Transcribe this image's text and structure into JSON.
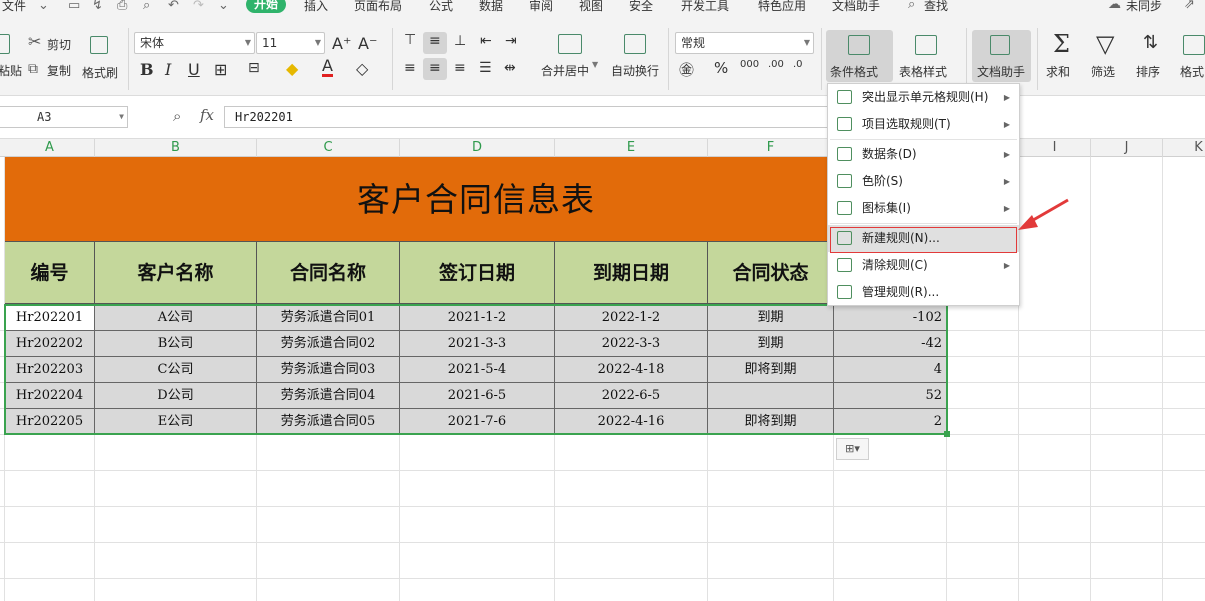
{
  "menubar": {
    "file": "文件",
    "tabs": [
      "开始",
      "插入",
      "页面布局",
      "公式",
      "数据",
      "审阅",
      "视图",
      "安全",
      "开发工具",
      "特色应用",
      "文档助手"
    ],
    "active_tab": "开始",
    "search": "查找",
    "sync": "未同步"
  },
  "ribbon": {
    "cut": "剪切",
    "paste": "粘贴",
    "copy": "复制",
    "format_painter": "格式刷",
    "font_name": "宋体",
    "font_size": "11",
    "merge_center": "合并居中",
    "wrap_text": "自动换行",
    "number_format": "常规",
    "conditional_format": "条件格式",
    "table_style": "表格样式",
    "doc_assistant": "文档助手",
    "sum": "求和",
    "filter": "筛选",
    "sort": "排序",
    "format": "格式"
  },
  "formula_bar": {
    "name_box": "A3",
    "fx": "fx",
    "value": "Hr202201"
  },
  "columns": [
    "A",
    "B",
    "C",
    "D",
    "E",
    "F",
    "G",
    "H",
    "I",
    "J",
    "K"
  ],
  "sheet": {
    "title": "客户合同信息表",
    "headers": [
      "编号",
      "客户名称",
      "合同名称",
      "签订日期",
      "到期日期",
      "合同状态"
    ],
    "rows": [
      [
        "Hr202201",
        "A公司",
        "劳务派遣合同01",
        "2021-1-2",
        "2022-1-2",
        "到期",
        "-102"
      ],
      [
        "Hr202202",
        "B公司",
        "劳务派遣合同02",
        "2021-3-3",
        "2022-3-3",
        "到期",
        "-42"
      ],
      [
        "Hr202203",
        "C公司",
        "劳务派遣合同03",
        "2021-5-4",
        "2022-4-18",
        "即将到期",
        "4"
      ],
      [
        "Hr202204",
        "D公司",
        "劳务派遣合同04",
        "2021-6-5",
        "2022-6-5",
        "",
        "52"
      ],
      [
        "Hr202205",
        "E公司",
        "劳务派遣合同05",
        "2021-7-6",
        "2022-4-16",
        "即将到期",
        "2"
      ]
    ]
  },
  "dropdown": {
    "items": [
      {
        "label": "突出显示单元格规则(H)",
        "submenu": true
      },
      {
        "label": "项目选取规则(T)",
        "submenu": true
      },
      {
        "label": "数据条(D)",
        "submenu": true
      },
      {
        "label": "色阶(S)",
        "submenu": true
      },
      {
        "label": "图标集(I)",
        "submenu": true
      },
      {
        "label": "新建规则(N)...",
        "submenu": false
      },
      {
        "label": "清除规则(C)",
        "submenu": true
      },
      {
        "label": "管理规则(R)...",
        "submenu": false
      }
    ],
    "highlighted": "新建规则(N)..."
  },
  "colors": {
    "title_fill": "#e26b0a",
    "header_fill": "#c4d79b",
    "data_fill": "#d9d9d9",
    "selection": "#3aa34f",
    "active_tab": "#2fb36b",
    "annotation": "#e23a3a"
  }
}
